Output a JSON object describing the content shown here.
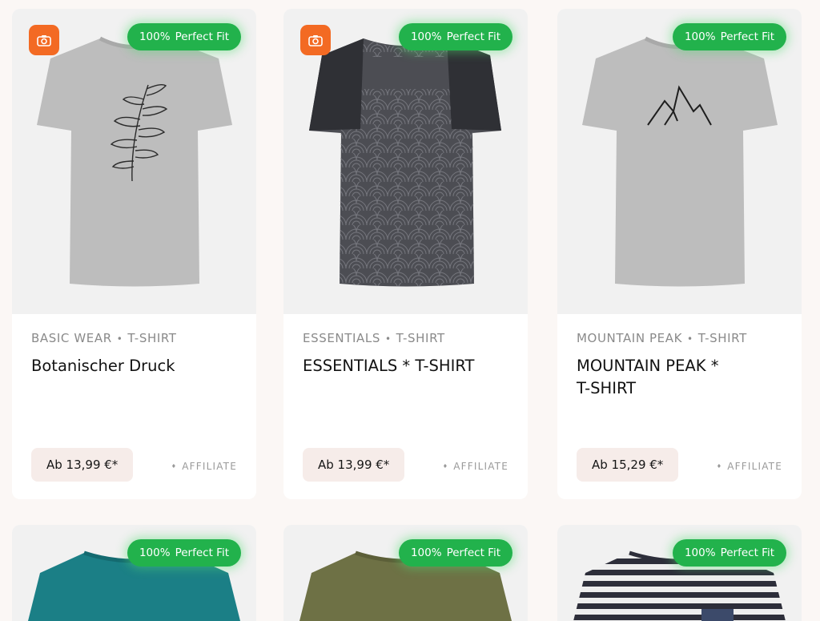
{
  "badge": {
    "percent": "100%",
    "label": "Perfect Fit"
  },
  "products": [
    {
      "brand": "BASIC WEAR",
      "category": "T-SHIRT",
      "title": "Botanischer Druck",
      "price": "Ab 13,99 €*",
      "affiliate": "AFFILIATE",
      "shirt_color": "#bdbdbd",
      "print": "leaf",
      "has_camera": true
    },
    {
      "brand": "ESSENTIALS",
      "category": "T-SHIRT",
      "title": "ESSENTIALS * T-SHIRT",
      "price": "Ab 13,99 €*",
      "affiliate": "AFFILIATE",
      "shirt_color": "#4c4d53",
      "print": "waves",
      "has_camera": true
    },
    {
      "brand": "MOUNTAIN PEAK",
      "category": "T-SHIRT",
      "title": "MOUNTAIN PEAK * T-SHIRT",
      "price": "Ab 15,29 €*",
      "affiliate": "AFFILIATE",
      "shirt_color": "#bdbdbd",
      "print": "mountain",
      "has_camera": false
    },
    {
      "shirt_color": "#1b7f86",
      "print": "plain"
    },
    {
      "shirt_color": "#6e7145",
      "print": "plain"
    },
    {
      "shirt_color": "#2d2e3a",
      "print": "stripes"
    }
  ],
  "colors": {
    "badge_green": "#22b24c",
    "camera_orange": "#f36a23",
    "price_bg": "#f6ece9"
  }
}
